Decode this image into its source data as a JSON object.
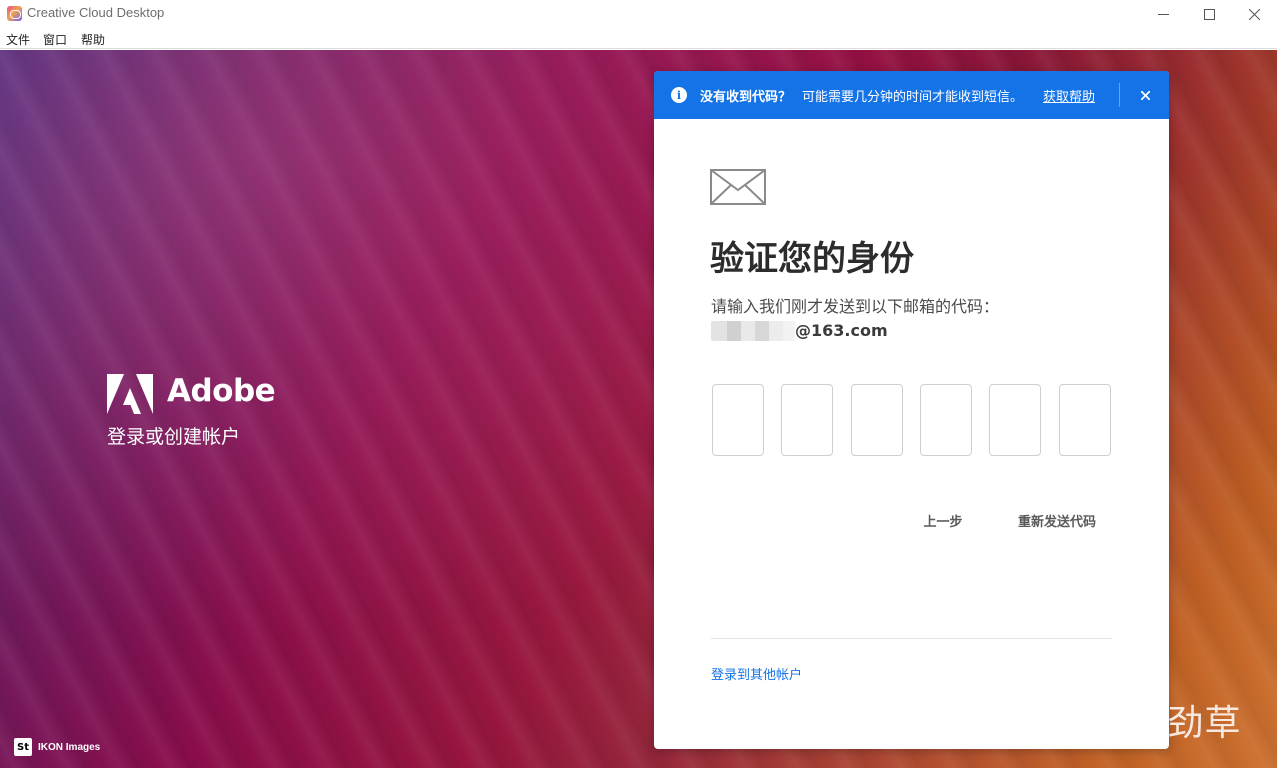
{
  "window": {
    "title": "Creative Cloud Desktop"
  },
  "menu": {
    "items": [
      "文件",
      "窗口",
      "帮助"
    ]
  },
  "brand": {
    "name": "Adobe",
    "tagline": "登录或创建帐户",
    "credit_badge": "St",
    "credit_text": "IKON Images"
  },
  "banner": {
    "bold_text": "没有收到代码？",
    "text": "可能需要几分钟的时间才能收到短信。",
    "link": "获取帮助",
    "close": "×"
  },
  "card": {
    "heading": "验证您的身份",
    "description": "请输入我们刚才发送到以下邮箱的代码：",
    "email_domain": "@163.com",
    "code_boxes": [
      "",
      "",
      "",
      "",
      "",
      ""
    ],
    "back_button": "上一步",
    "resend_button": "重新发送代码",
    "other_account_link": "登录到其他帐户"
  },
  "watermark": "知乎 @疾风劲草",
  "colors": {
    "accent": "#1473e6",
    "heading": "#2c2c2c"
  }
}
